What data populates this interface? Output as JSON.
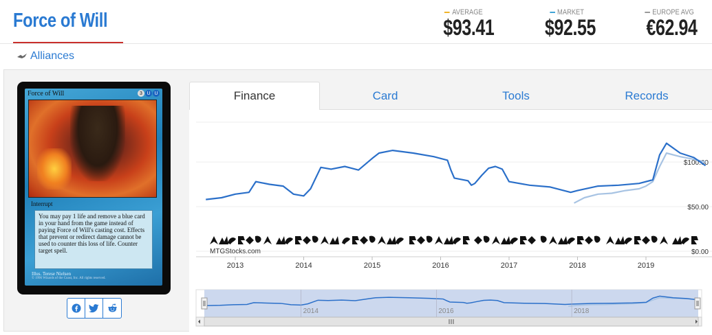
{
  "card": {
    "title": "Force of Will",
    "set_name": "Alliances",
    "name_on_card": "Force of Will",
    "mana_cost": [
      "3",
      "U",
      "U"
    ],
    "type_line": "Interrupt",
    "rules_text": "You may pay 1 life and remove a blue card in your hand from the game instead of paying Force of Will's casting cost. Effects that prevent or redirect damage cannot be used to counter this loss of life. Counter target spell.",
    "illustrator": "Illus. Terese Nielsen",
    "copyright": "© 1996 Wizards of the Coast, Inc. All rights reserved."
  },
  "prices": [
    {
      "label": "AVERAGE",
      "value": "$93.41",
      "color": "#f0b429"
    },
    {
      "label": "MARKET",
      "value": "$92.55",
      "color": "#3fa3d6"
    },
    {
      "label": "EUROPE AVG",
      "value": "€62.94",
      "color": "#999999"
    }
  ],
  "share": {
    "facebook_icon": "facebook-icon",
    "twitter_icon": "twitter-icon",
    "reddit_icon": "reddit-icon"
  },
  "tabs": [
    {
      "label": "Finance",
      "active": true
    },
    {
      "label": "Card",
      "active": false
    },
    {
      "label": "Tools",
      "active": false
    },
    {
      "label": "Records",
      "active": false
    }
  ],
  "chart_data": {
    "type": "line",
    "credit": "MTGStocks.com",
    "x_ticks": [
      "2013",
      "2014",
      "2015",
      "2016",
      "2017",
      "2018",
      "2019"
    ],
    "y_ticks": [
      "$100.00",
      "$50.00",
      "$0.00"
    ],
    "ylim": [
      0,
      150
    ],
    "navigator_labels": [
      "2014",
      "2016",
      "2018"
    ],
    "series": [
      {
        "color": "#2a6fc9",
        "x": [
          2012.57,
          2012.8,
          2013.0,
          2013.2,
          2013.3,
          2013.5,
          2013.7,
          2013.85,
          2014.0,
          2014.1,
          2014.2,
          2014.25,
          2014.4,
          2014.6,
          2014.8,
          2015.0,
          2015.1,
          2015.3,
          2015.6,
          2015.9,
          2016.1,
          2016.15,
          2016.2,
          2016.4,
          2016.45,
          2016.5,
          2016.6,
          2016.7,
          2016.8,
          2016.9,
          2017.0,
          2017.3,
          2017.6,
          2017.9,
          2018.0,
          2018.3,
          2018.6,
          2018.9,
          2019.1,
          2019.2,
          2019.3,
          2019.5,
          2019.7,
          2019.87
        ],
        "y": [
          58,
          60,
          64,
          66,
          78,
          75,
          73,
          64,
          62,
          70,
          86,
          94,
          92,
          95,
          91,
          104,
          110,
          113,
          110,
          106,
          102,
          91,
          82,
          79,
          74,
          76,
          85,
          93,
          95,
          92,
          78,
          74,
          72,
          66,
          68,
          73,
          74,
          76,
          80,
          108,
          121,
          110,
          105,
          96
        ]
      },
      {
        "color": "#a7c3e3",
        "x": [
          2017.95,
          2018.1,
          2018.3,
          2018.5,
          2018.7,
          2018.9,
          2019.0,
          2019.1,
          2019.2,
          2019.3,
          2019.5,
          2019.7,
          2019.87
        ],
        "y": [
          54,
          60,
          64,
          65,
          68,
          70,
          73,
          78,
          95,
          110,
          106,
          103,
          100
        ]
      }
    ]
  }
}
